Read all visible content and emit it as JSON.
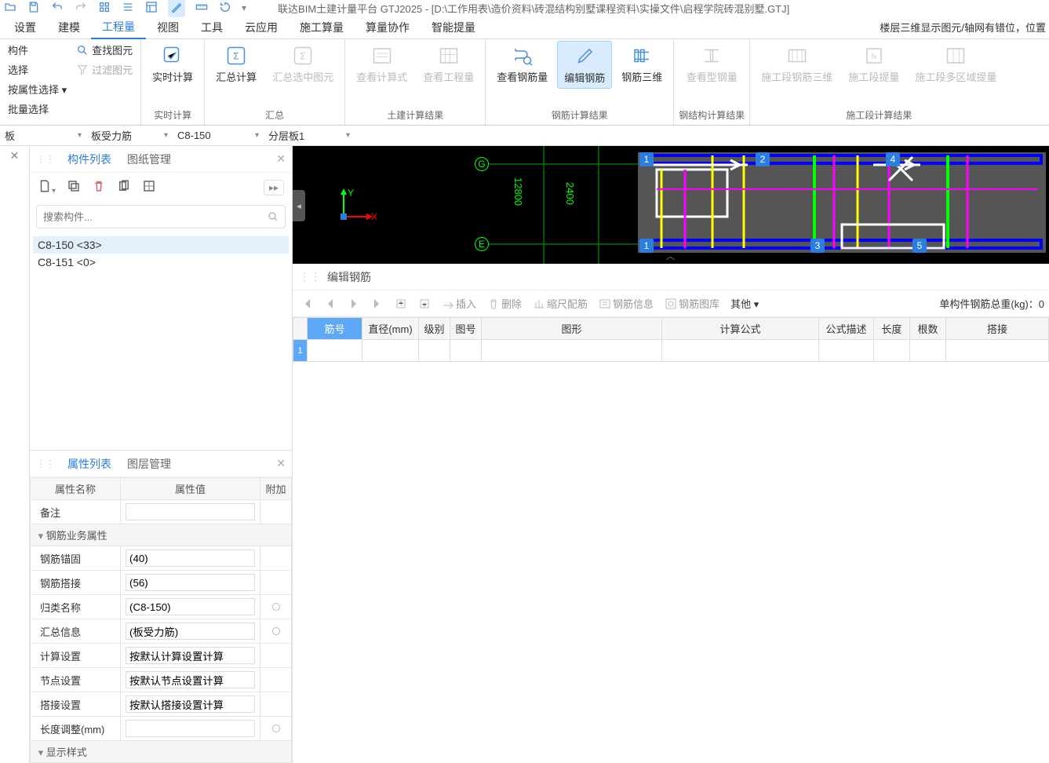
{
  "title": "联达BIM土建计量平台 GTJ2025 - [D:\\工作用表\\造价资料\\砖混结构别墅课程资料\\实操文件\\启程学院砖混别墅.GTJ]",
  "right_info": "楼层三维显示图元/轴网有错位，位置",
  "menu": [
    "设置",
    "建模",
    "工程量",
    "视图",
    "工具",
    "云应用",
    "施工算量",
    "算量协作",
    "智能提量"
  ],
  "menu_active": 2,
  "ribbon": {
    "g1": {
      "items": [
        "构件",
        "选择",
        "按属性选择 ▾",
        "批量选择"
      ],
      "find": "查找图元",
      "filter": "过滤图元"
    },
    "realtime": {
      "btn": "实时计算",
      "label": "实时计算"
    },
    "summary": {
      "btn1": "汇总计算",
      "btn2": "汇总选中图元",
      "label": "汇总"
    },
    "civil": {
      "btn1": "查看计算式",
      "btn2": "查看工程量",
      "label": "土建计算结果"
    },
    "rebar": {
      "btn1": "查看钢筋量",
      "btn2": "编辑钢筋",
      "btn3": "钢筋三维",
      "label": "钢筋计算结果"
    },
    "steel": {
      "btn1": "查看型钢量",
      "label": "钢结构计算结果"
    },
    "constr": {
      "btn1": "施工段钢筋三维",
      "btn2": "施工段提量",
      "btn3": "施工段多区域提量",
      "label": "施工段计算结果"
    }
  },
  "selectors": {
    "s1": "板",
    "s2": "板受力筋",
    "s3": "C8-150",
    "s4": "分层板1"
  },
  "left": {
    "tab1": "构件列表",
    "tab2": "图纸管理",
    "search_placeholder": "搜索构件...",
    "items": [
      "C8-150 <33>",
      "C8-151 <0>"
    ]
  },
  "prop": {
    "tab1": "属性列表",
    "tab2": "图层管理",
    "h_name": "属性名称",
    "h_val": "属性值",
    "h_extra": "附加",
    "rows": [
      {
        "n": "备注",
        "v": ""
      },
      {
        "cat": "钢筋业务属性"
      },
      {
        "n": "钢筋锚固",
        "v": "(40)"
      },
      {
        "n": "钢筋搭接",
        "v": "(56)"
      },
      {
        "n": "归类名称",
        "v": "(C8-150)",
        "dot": true
      },
      {
        "n": "汇总信息",
        "v": "(板受力筋)",
        "dot": true
      },
      {
        "n": "计算设置",
        "v": "按默认计算设置计算"
      },
      {
        "n": "节点设置",
        "v": "按默认节点设置计算"
      },
      {
        "n": "搭接设置",
        "v": "按默认搭接设置计算"
      },
      {
        "n": "长度调整(mm)",
        "v": "",
        "dot": true
      },
      {
        "cat": "显示样式"
      }
    ]
  },
  "viewport": {
    "grid_rows": [
      "G",
      "E"
    ],
    "grid_cols": [
      "1",
      "2",
      "3",
      "4",
      "5"
    ],
    "dims": [
      "12800",
      "2400"
    ]
  },
  "edit": {
    "title": "编辑钢筋",
    "tb": {
      "insert": "插入",
      "delete": "删除",
      "scale": "缩尺配筋",
      "info": "钢筋信息",
      "lib": "钢筋图库",
      "other": "其他 ▾"
    },
    "total_label": "单构件钢筋总重(kg)：",
    "total_val": "0",
    "cols": [
      "筋号",
      "直径(mm)",
      "级别",
      "图号",
      "图形",
      "计算公式",
      "公式描述",
      "长度",
      "根数",
      "搭接"
    ]
  }
}
